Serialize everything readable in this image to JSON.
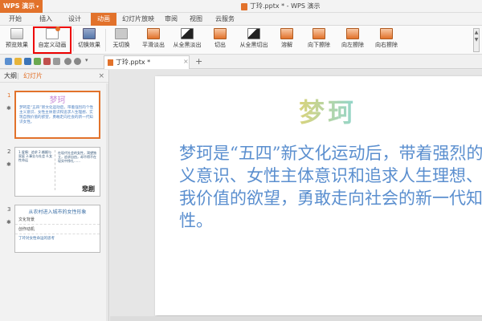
{
  "app": {
    "name": "WPS 演示",
    "caret": "▾"
  },
  "window": {
    "title": "丁玲.pptx * - WPS 演示"
  },
  "menu": {
    "tabs": [
      "开始",
      "插入",
      "设计",
      "动画",
      "幻灯片放映",
      "审阅",
      "视图",
      "云服务"
    ],
    "active": "动画"
  },
  "ribbon": {
    "preview": "预览效果",
    "custom_animation": "自定义动画",
    "switch_effect": "切换效果",
    "transitions": [
      "无切换",
      "平滑淡出",
      "从全黑淡出",
      "切出",
      "从全黑切出",
      "溶解",
      "向下擦除",
      "向左擦除",
      "向右擦除"
    ]
  },
  "doc_tab": {
    "label": "丁玲.pptx *",
    "close": "×",
    "add": "+"
  },
  "panel": {
    "tabs": [
      "大纲",
      "幻灯片"
    ],
    "active": "幻灯片",
    "close": "×",
    "slide_numbers": [
      "1",
      "2",
      "3"
    ]
  },
  "thumbs": {
    "t1_title": "梦珂",
    "t1_body": "梦珂是“五四”新文化运动后，带着强烈的个性主义意识、女性主体意识和追求人生理想、实现自我价值的欲望，勇敢走向社会的新一代知识女性。",
    "t2_left": "1.爱情：追求 2.婚姻与家庭 3.事业与社会 4.女性命运",
    "t2_right": "在现代社会的女性，渴望独立，追求自由，却不得不在现实中挣扎……",
    "t2_sig": "悲剧",
    "t3_title": "从农村进入城市的女性形象",
    "t3_rows": [
      "文化背景",
      "创作动机"
    ],
    "t3_foot": "丁玲对女性命运的思考"
  },
  "slide": {
    "title": "梦珂",
    "body": "梦珂是“五四”新文化运动后，带着强烈的个性主义意识、女性主体意识和追求人生理想、实现自我价值的欲望，勇敢走向社会的新一代知识女性。"
  },
  "colors": {
    "accent": "#e2722b",
    "slide_text": "#5b8fcf",
    "highlight": "#e00000"
  }
}
